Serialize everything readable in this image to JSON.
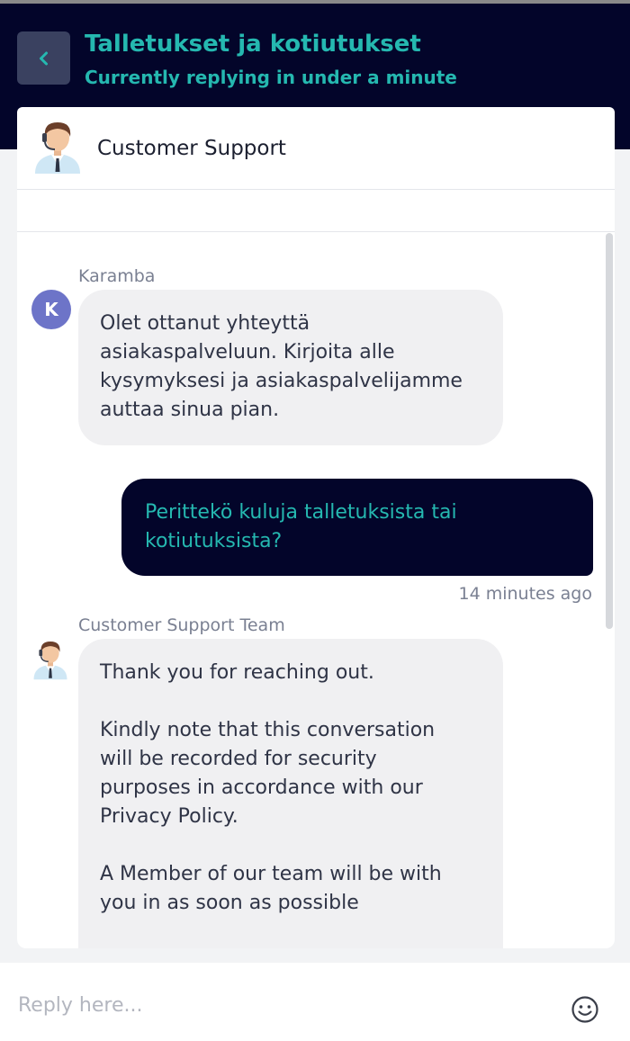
{
  "header": {
    "back_icon": "chevron-left-icon",
    "title": "Talletukset ja kotiutukset",
    "subtitle": "Currently replying in under a minute"
  },
  "agent": {
    "avatar_icon": "support-agent-avatar",
    "name": "Customer Support"
  },
  "messages": [
    {
      "sender": "Karamba",
      "avatar_initial": "K",
      "direction": "incoming",
      "text": "Olet ottanut yhteyttä\nasiakaspalveluun. Kirjoita  alle\nkysymyksesi ja asiakaspalvelijamme\nauttaa sinua pian."
    },
    {
      "direction": "outgoing",
      "text": "Perittekö kuluja talletuksista tai\nkotiutuksista?",
      "time": "14 minutes ago"
    },
    {
      "sender": "Customer Support Team",
      "avatar_icon": "support-agent-avatar",
      "direction": "incoming",
      "text": "Thank you for reaching out.\n\nKindly note that this conversation\nwill be recorded for security\npurposes in accordance with our\nPrivacy Policy.\n\nA Member of our team will be with\nyou in as soon as possible"
    }
  ],
  "reply": {
    "placeholder": "Reply here...",
    "emoji_icon": "smiley-icon"
  },
  "colors": {
    "header_bg": "#03052a",
    "accent_teal": "#25b8b0",
    "avatar_purple": "#6d74c8",
    "incoming_bubble": "#f0f0f2"
  }
}
